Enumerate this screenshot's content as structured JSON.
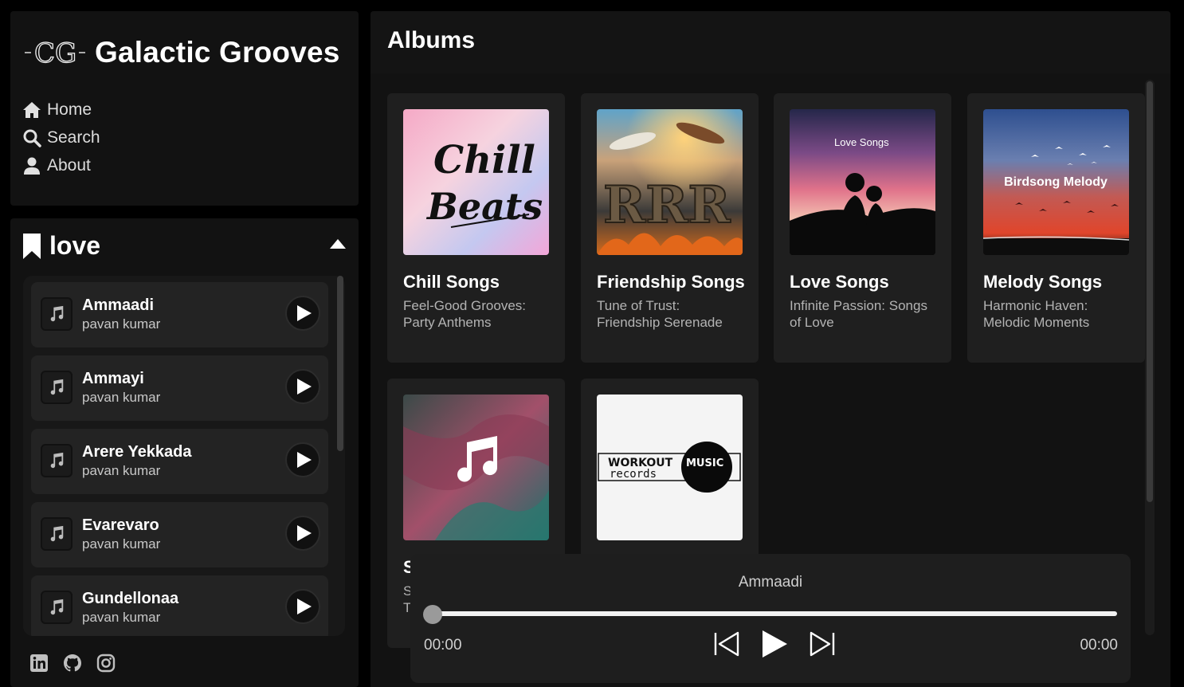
{
  "brand": {
    "name": "Galactic Grooves",
    "logo_text": "CG"
  },
  "nav": [
    {
      "label": "Home",
      "icon": "home-icon"
    },
    {
      "label": "Search",
      "icon": "search-icon"
    },
    {
      "label": "About",
      "icon": "user-icon"
    }
  ],
  "library": {
    "title": "love",
    "songs": [
      {
        "name": "Ammaadi",
        "artist": "pavan kumar"
      },
      {
        "name": "Ammayi",
        "artist": "pavan kumar"
      },
      {
        "name": "Arere Yekkada",
        "artist": "pavan kumar"
      },
      {
        "name": "Evarevaro",
        "artist": "pavan kumar"
      },
      {
        "name": "Gundellonaa",
        "artist": "pavan kumar"
      }
    ]
  },
  "socials": [
    "linkedin-icon",
    "github-icon",
    "instagram-icon"
  ],
  "main": {
    "title": "Albums",
    "albums": [
      {
        "title": "Chill Songs",
        "desc": "Feel-Good Grooves: Party Anthems",
        "art_text": [
          "Chill",
          "Beats"
        ]
      },
      {
        "title": "Friendship Songs",
        "desc": "Tune of Trust: Friendship Serenade",
        "art_text": [
          "RRR"
        ]
      },
      {
        "title": "Love Songs",
        "desc": "Infinite Passion: Songs of Love",
        "art_text": [
          "Love Songs"
        ]
      },
      {
        "title": "Melody Songs",
        "desc": "Harmonic Haven: Melodic Moments",
        "art_text": [
          "Birdsong Melody"
        ]
      },
      {
        "title": "S",
        "desc": "S\nT",
        "art_text": []
      },
      {
        "title": "",
        "desc": "",
        "art_text": [
          "WORKOUT",
          "MUSIC",
          "records"
        ]
      }
    ]
  },
  "player": {
    "current_song": "Ammaadi",
    "current_time": "00:00",
    "duration": "00:00",
    "progress": 0
  },
  "colors": {
    "bg": "#000000",
    "panel": "#121212",
    "card": "#1f1f1f",
    "text": "#ffffff",
    "muted": "#b3b3b3"
  }
}
